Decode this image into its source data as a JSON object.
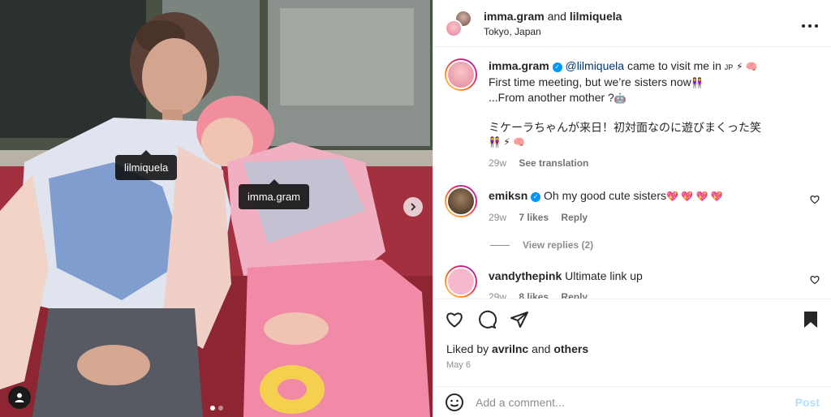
{
  "header": {
    "user1": "imma.gram",
    "joiner": " and ",
    "user2": "lilmiquela",
    "location": "Tokyo, Japan",
    "more_icon": "more-horizontal-icon"
  },
  "media": {
    "tags": [
      "lilmiquela",
      "imma.gram"
    ],
    "carousel_index": 1,
    "carousel_count": 2
  },
  "caption": {
    "user": "imma.gram",
    "mention": "@lilmiquela",
    "line1_rest": " came to visit me in ",
    "line1_flag": "JP",
    "line1_emoji": "⚡ 🧠",
    "line2": "First time meeting, but we’re sisters now",
    "line2_emoji": "👭",
    "line3": "...From another mother ?",
    "line3_emoji": "🤖",
    "line4": "ミケーラちゃんが来日！初対面なのに遊びまくった笑",
    "line5_emoji": "👭 ⚡ 🧠",
    "time": "29w",
    "see_translation": "See translation"
  },
  "comments": [
    {
      "user": "emiksn",
      "text": "Oh my good cute sisters",
      "emoji": "💖 💖 💖 💖",
      "time": "29w",
      "likes": "7 likes",
      "reply": "Reply",
      "view_replies": "View replies (2)"
    },
    {
      "user": "vandythepink",
      "text": "Ultimate link up",
      "time": "29w",
      "likes": "8 likes",
      "reply": "Reply"
    }
  ],
  "footer": {
    "liked_by_prefix": "Liked by ",
    "liked_by_user": "avrilnc",
    "liked_by_middle": " and ",
    "liked_by_others": "others",
    "date": "May 6",
    "comment_placeholder": "Add a comment...",
    "post_label": "Post"
  }
}
